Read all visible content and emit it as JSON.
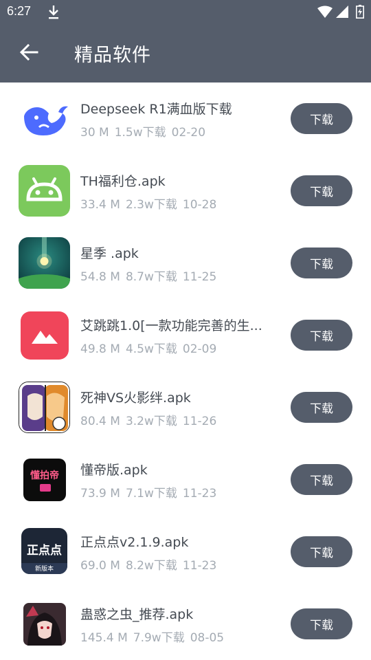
{
  "status": {
    "time": "6:27"
  },
  "appbar": {
    "title": "精品软件"
  },
  "apps": [
    {
      "name": "Deepseek R1满血版下载",
      "size": "30 M",
      "downloads": "1.5w下载",
      "date": "02-20",
      "button": "下载",
      "icon": "deepseek-whale-icon"
    },
    {
      "name": "TH福利仓.apk",
      "size": "33.4 M",
      "downloads": "2.3w下载",
      "date": "10-28",
      "button": "下载",
      "icon": "android-icon"
    },
    {
      "name": "星季 .apk",
      "size": "54.8 M",
      "downloads": "8.7w下载",
      "date": "11-25",
      "button": "下载",
      "icon": "planet-light-icon"
    },
    {
      "name": "艾跳跳1.0[一款功能完善的生...",
      "size": "49.8 M",
      "downloads": "4.5w下载",
      "date": "02-09",
      "button": "下载",
      "icon": "mountain-photo-icon"
    },
    {
      "name": "死神VS火影绊.apk",
      "size": "80.4 M",
      "downloads": "3.2w下载",
      "date": "11-26",
      "button": "下载",
      "icon": "anime-characters-icon"
    },
    {
      "name": "懂帝版.apk",
      "size": "73.9 M",
      "downloads": "7.1w下载",
      "date": "11-23",
      "button": "下载",
      "icon": "video-app-icon",
      "icon_text": "懂拍帝"
    },
    {
      "name": "正点点v2.1.9.apk",
      "size": "69.0 M",
      "downloads": "8.2w下载",
      "date": "11-23",
      "button": "下载",
      "icon": "zhengdiandian-icon",
      "icon_text": "正点点",
      "icon_sub": "新版本"
    },
    {
      "name": "蛊惑之虫_推荐.apk",
      "size": "145.4 M",
      "downloads": "7.9w下载",
      "date": "08-05",
      "button": "下载",
      "icon": "anime-portrait-icon"
    }
  ]
}
